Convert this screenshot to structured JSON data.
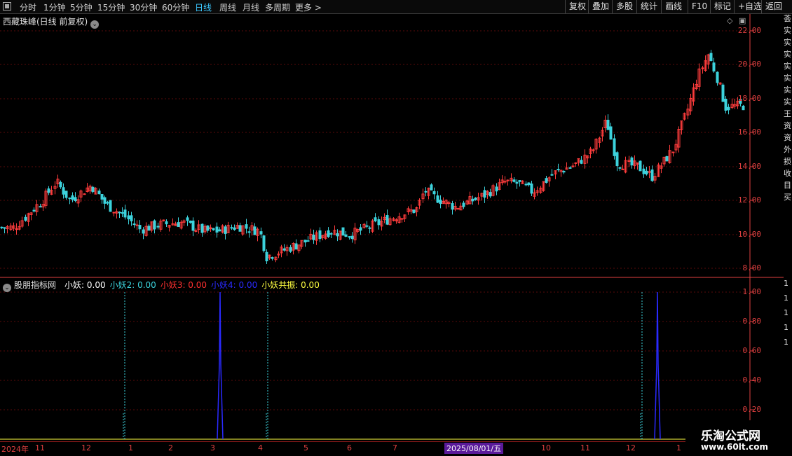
{
  "toolbar": {
    "periods": [
      "分时",
      "1分钟",
      "5分钟",
      "15分钟",
      "30分钟",
      "60分钟",
      "日线",
      "周线",
      "月线",
      "多周期",
      "更多 >"
    ],
    "active_period": "日线",
    "buttons": [
      "复权",
      "叠加",
      "多股",
      "统计",
      "画线",
      "F10",
      "标记",
      "+自选",
      "返回"
    ]
  },
  "main_chart": {
    "title": "西藏珠峰(日线 前复权)",
    "y_ticks": [
      "22.00",
      "20.00",
      "18.00",
      "16.00",
      "14.00",
      "12.00",
      "10.00",
      "8.00"
    ]
  },
  "indicator": {
    "name": "股朋指标网",
    "lines": [
      {
        "label": "小妖: 0.00",
        "color": "#ffffff"
      },
      {
        "label": "小妖2: 0.00",
        "color": "#3cd2dc"
      },
      {
        "label": "小妖3: 0.00",
        "color": "#ff3030"
      },
      {
        "label": "小妖4: 0.00",
        "color": "#2a2aff"
      },
      {
        "label": "小妖共振: 0.00",
        "color": "#ffff40"
      }
    ],
    "y_ticks": [
      "1.00",
      "0.80",
      "0.60",
      "0.40",
      "0.20"
    ]
  },
  "date_axis": {
    "labels": [
      "2024年",
      "11",
      "12",
      "1",
      "2",
      "3",
      "4",
      "5",
      "6",
      "7",
      "10",
      "11",
      "12",
      "1"
    ],
    "cursor_date": "2025/08/01/五"
  },
  "right_column": [
    "荟",
    "实",
    "实",
    "实",
    "实",
    "实",
    "实",
    "实",
    "王",
    "资",
    "资",
    "外",
    "损",
    "收",
    "目",
    "买",
    "1",
    "1",
    "1",
    "1",
    "1"
  ],
  "watermark": {
    "line1": "乐淘公式网",
    "line2": "www.60lt.com"
  },
  "colors": {
    "up": "#ff3c3c",
    "down": "#3cd2dc",
    "grid": "#5a0a0a",
    "axis": "#e04040"
  }
}
